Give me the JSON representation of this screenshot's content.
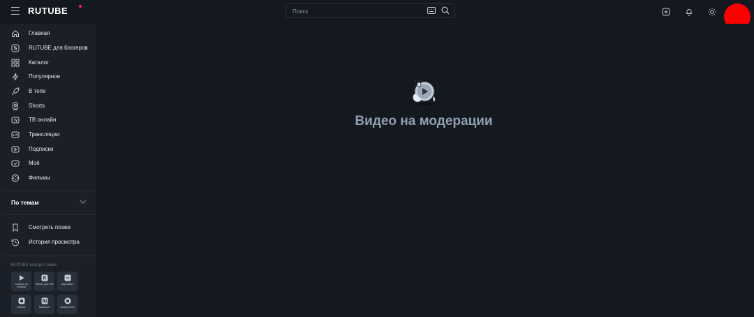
{
  "header": {
    "logo": "RUTUBE",
    "search_placeholder": "Поиск"
  },
  "sidebar": {
    "items": [
      {
        "label": "Главная",
        "icon": "home-icon"
      },
      {
        "label": "RUTUBE для блогеров",
        "icon": "studio-icon"
      },
      {
        "label": "Каталог",
        "icon": "catalog-icon"
      },
      {
        "label": "Популярное",
        "icon": "lightning-icon"
      },
      {
        "label": "В топе",
        "icon": "rocket-icon"
      },
      {
        "label": "Shorts",
        "icon": "shorts-icon"
      },
      {
        "label": "ТВ онлайн",
        "icon": "tv-icon"
      },
      {
        "label": "Трансляции",
        "icon": "live-icon"
      },
      {
        "label": "Подписки",
        "icon": "subscriptions-icon"
      },
      {
        "label": "Моё",
        "icon": "my-icon"
      },
      {
        "label": "Фильмы",
        "icon": "films-icon"
      }
    ],
    "topics_label": "По темам",
    "secondary": [
      {
        "label": "Смотреть позже",
        "icon": "bookmark-icon"
      },
      {
        "label": "История просмотра",
        "icon": "history-icon"
      }
    ],
    "apps_title": "RUTUBE всегда с вами",
    "apps": [
      {
        "label": "Скачать на Android",
        "icon": "google-play-icon"
      },
      {
        "label": "Rutube для iOS",
        "icon": "ios-icon"
      },
      {
        "label": "AppGallery",
        "icon": "appgallery-icon"
      },
      {
        "label": "Rustore",
        "icon": "rustore-icon"
      },
      {
        "label": "RuMarket",
        "icon": "rumarket-icon"
      },
      {
        "label": "Galaxy Store",
        "icon": "galaxy-store-icon"
      }
    ]
  },
  "main": {
    "status_title": "Видео на модерации"
  },
  "colors": {
    "background": "#14191f",
    "sidebar": "#1b2028",
    "title": "#8f9fb2",
    "brand_accent": "#ff2255",
    "avatar": "#ff0000"
  }
}
